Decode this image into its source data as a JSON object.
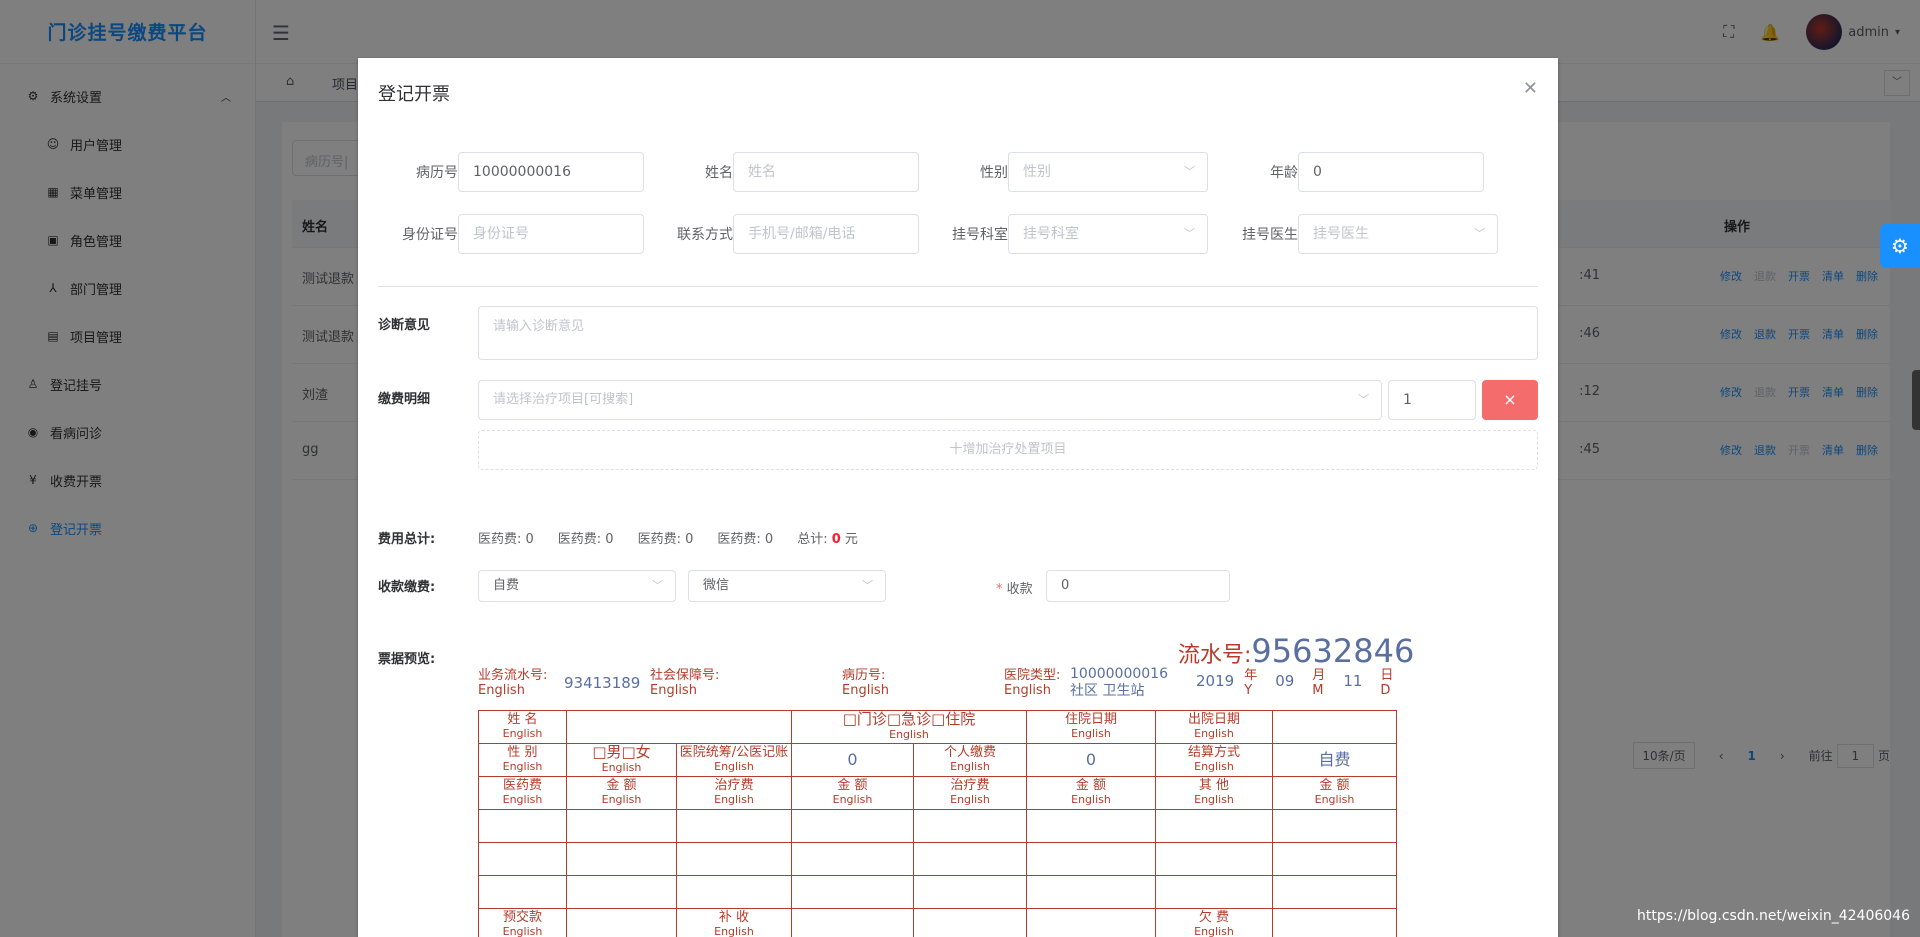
{
  "app": {
    "title": "门诊挂号缴费平台",
    "user": "admin"
  },
  "sidebar": {
    "items": [
      {
        "label": "系统设置",
        "icon": "gear-icon"
      },
      {
        "label": "用户管理",
        "icon": "user-icon"
      },
      {
        "label": "菜单管理",
        "icon": "menu-icon"
      },
      {
        "label": "角色管理",
        "icon": "role-icon"
      },
      {
        "label": "部门管理",
        "icon": "org-icon"
      },
      {
        "label": "项目管理",
        "icon": "project-icon"
      },
      {
        "label": "登记挂号",
        "icon": "person-icon"
      },
      {
        "label": "看病问诊",
        "icon": "eye-icon"
      },
      {
        "label": "收费开票",
        "icon": "yen-icon"
      },
      {
        "label": "登记开票",
        "icon": "plus-circle-icon"
      }
    ]
  },
  "tags": {
    "current": "项目"
  },
  "bg_table": {
    "search_placeholder": "病历号|",
    "col_name": "姓名",
    "col_ops": "操作",
    "rows": [
      {
        "name": "测试退款",
        "time": ":41"
      },
      {
        "name": "测试退款",
        "time": ":46"
      },
      {
        "name": "刘渣",
        "time": ":12"
      },
      {
        "name": "gg",
        "time": ":45"
      }
    ],
    "ops": {
      "edit": "修改",
      "refund": "退款",
      "invoice": "开票",
      "list": "清单",
      "delete": "删除"
    },
    "pager": {
      "size": "10条/页",
      "page": "1",
      "goto": "前往",
      "goto_val": "1",
      "unit": "页"
    }
  },
  "dialog": {
    "title": "登记开票",
    "form": {
      "case_no": {
        "label": "病历号",
        "value": "10000000016"
      },
      "name": {
        "label": "姓名",
        "placeholder": "姓名"
      },
      "gender": {
        "label": "性别",
        "placeholder": "性别"
      },
      "age": {
        "label": "年龄",
        "value": "0"
      },
      "id_no": {
        "label": "身份证号",
        "placeholder": "身份证号"
      },
      "contact": {
        "label": "联系方式",
        "placeholder": "手机号/邮箱/电话"
      },
      "dept": {
        "label": "挂号科室",
        "placeholder": "挂号科室"
      },
      "doctor": {
        "label": "挂号医生",
        "placeholder": "挂号医生"
      }
    },
    "diagnosis": {
      "label": "诊断意见",
      "placeholder": "请输入诊断意见"
    },
    "items": {
      "label": "缴费明细",
      "placeholder": "请选择治疗项目[可搜索]",
      "qty": "1",
      "del": "×",
      "add": "十增加治疗处置项目"
    },
    "fees": {
      "label": "费用总计:",
      "f1": "医药费: 0",
      "f2": "医药费: 0",
      "f3": "医药费: 0",
      "f4": "医药费: 0",
      "total_label": "总计:",
      "total": "0",
      "unit": "元"
    },
    "pay": {
      "label": "收款缴费:",
      "type": "自费",
      "method": "微信",
      "req": "*",
      "recv_label": "收款",
      "recv": "0"
    },
    "preview": {
      "label": "票据预览:",
      "serial_label": "流水号:",
      "serial": "95632846",
      "biz_label": "业务流水号:",
      "biz_en": "English",
      "biz": "93413189",
      "ss_label": "社会保障号:",
      "ss_en": "English",
      "case_label": "病历号:",
      "case_en": "English",
      "hosp_label": "医院类型:",
      "hosp_en": "English",
      "hosp_case": "10000000016",
      "hosp_type": "社区 卫生站",
      "year": "2019",
      "year_cn": "年",
      "year_en": "Y",
      "month": "09",
      "month_cn": "月",
      "month_en": "M",
      "day": "11",
      "day_cn": "日",
      "day_en": "D",
      "en": "English",
      "r_name": "姓 名",
      "r_visit": "□门诊□急诊□住院",
      "r_in": "住院日期",
      "r_out": "出院日期",
      "r_gender": "性 别",
      "r_mf": "□男□女",
      "r_ins": "医院统筹/公医记账",
      "r_ins_val": "0",
      "r_self": "个人缴费",
      "r_self_val": "0",
      "r_settle": "结算方式",
      "r_settle_val": "自费",
      "h_drug": "医药费",
      "h_amt": "金 额",
      "h_treat": "治疗费",
      "h_other": "其 他",
      "r_prepay": "预交款",
      "r_supp": "补 收",
      "r_owe": "欠 费"
    }
  },
  "watermark": "https://blog.csdn.net/weixin_42406046"
}
